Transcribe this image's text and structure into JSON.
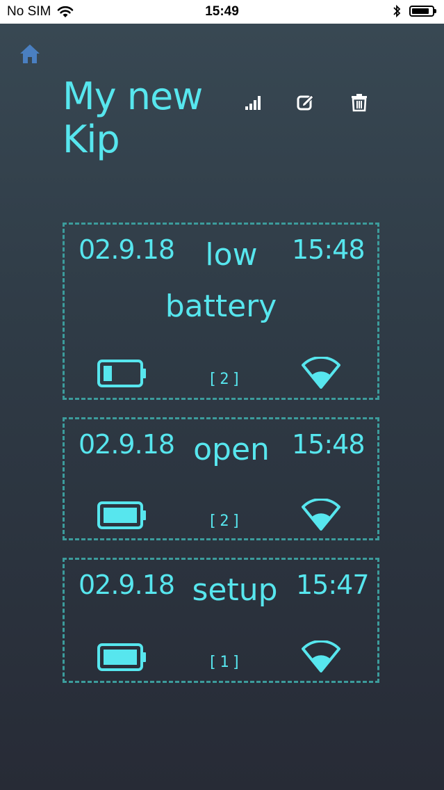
{
  "status_bar": {
    "carrier": "No SIM",
    "time": "15:49"
  },
  "header": {
    "title_line1": "My new",
    "title_line2": "Kip"
  },
  "icons": {
    "home": "home-icon",
    "signal": "signal-strength-icon",
    "edit": "edit-icon",
    "delete": "trash-icon"
  },
  "colors": {
    "accent": "#57e6ee",
    "border": "#3c9c9c",
    "home": "#4a7fc1"
  },
  "events": [
    {
      "date": "02.9.18",
      "event": "low",
      "event_line2": "battery",
      "time": "15:48",
      "count": "[2]",
      "battery_level": 0.25
    },
    {
      "date": "02.9.18",
      "event": "open",
      "event_line2": "",
      "time": "15:48",
      "count": "[2]",
      "battery_level": 1.0
    },
    {
      "date": "02.9.18",
      "event": "setup",
      "event_line2": "",
      "time": "15:47",
      "count": "[1]",
      "battery_level": 1.0
    }
  ]
}
